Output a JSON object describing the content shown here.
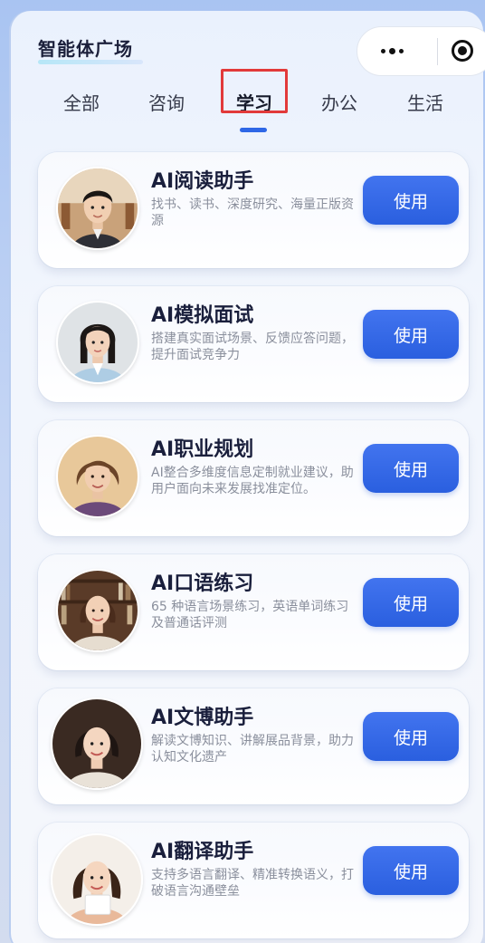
{
  "header": {
    "title": "智能体广场",
    "capsule": {
      "more_icon": "more-dots-icon",
      "close_icon": "target-circle-icon"
    }
  },
  "tabs": [
    {
      "label": "全部",
      "active": false
    },
    {
      "label": "咨询",
      "active": false
    },
    {
      "label": "学习",
      "active": true
    },
    {
      "label": "办公",
      "active": false
    },
    {
      "label": "生活",
      "active": false
    }
  ],
  "colors": {
    "accent": "#2e67e6",
    "button": "#3468e8",
    "highlight_border": "#e23a3a",
    "title_text": "#1a1f3c",
    "desc_text": "#8a8f9c"
  },
  "agents": [
    {
      "title": "AI阅读助手",
      "description": "找书、读书、深度研究、海量正版资源",
      "button": "使用",
      "avatar": "young-man-avatar"
    },
    {
      "title": "AI模拟面试",
      "description": "搭建真实面试场景、反馈应答问题，提升面试竞争力",
      "button": "使用",
      "avatar": "young-woman-avatar"
    },
    {
      "title": "AI职业规划",
      "description": "AI整合多维度信息定制就业建议，助用户面向未来发展找准定位。",
      "button": "使用",
      "avatar": "woman-advisor-avatar"
    },
    {
      "title": "AI口语练习",
      "description": "65 种语言场景练习，英语单词练习及普通话评测",
      "button": "使用",
      "avatar": "library-woman-avatar"
    },
    {
      "title": "AI文博助手",
      "description": "解读文博知识、讲解展品背景，助力认知文化遗产",
      "button": "使用",
      "avatar": "museum-guide-avatar"
    },
    {
      "title": "AI翻译助手",
      "description": "支持多语言翻译、精准转换语义，打破语言沟通壁垒",
      "button": "使用",
      "avatar": "translator-woman-avatar"
    }
  ]
}
